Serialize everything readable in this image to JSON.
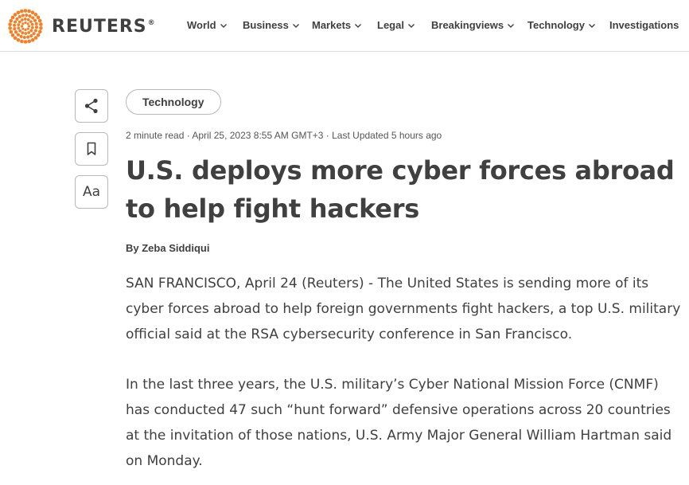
{
  "header": {
    "logo": {
      "text": "REUTERS",
      "registered": "®",
      "icon": "reuters-dots-logo"
    },
    "nav": [
      {
        "label": "World",
        "has_dropdown": true
      },
      {
        "label": "Business",
        "has_dropdown": true
      },
      {
        "label": "Markets",
        "has_dropdown": true
      },
      {
        "label": "Legal",
        "has_dropdown": true
      },
      {
        "label": "Breakingviews",
        "has_dropdown": true
      },
      {
        "label": "Technology",
        "has_dropdown": true
      },
      {
        "label": "Investigations",
        "has_dropdown": false
      }
    ]
  },
  "tools": {
    "share_icon": "share-icon",
    "bookmark_icon": "bookmark-icon",
    "text_size_label": "Aa"
  },
  "article": {
    "section_tag": "Technology",
    "meta": "2 minute read · April 25, 2023 8:55 AM GMT+3 · Last Updated 5 hours ago",
    "headline": "U.S. deploys more cyber forces abroad to help fight hackers",
    "byline_prefix": "By ",
    "author": "Zeba Siddiqui",
    "paragraphs": [
      "SAN FRANCISCO, April 24 (Reuters) - The United States is sending more of its cyber forces abroad to help foreign governments fight hackers, a top U.S. military official said at the RSA cybersecurity conference in San Francisco.",
      "In the last three years, the U.S. military’s Cyber National Mission Force (CNMF) has conducted 47 such “hunt forward” defensive operations across 20 countries at the invitation of those nations, U.S. Army Major General William Hartman said on Monday."
    ]
  },
  "colors": {
    "brand_orange": "#f47f24",
    "text": "#404040",
    "border": "#b8b8b8",
    "divider": "#dcdcdc"
  }
}
